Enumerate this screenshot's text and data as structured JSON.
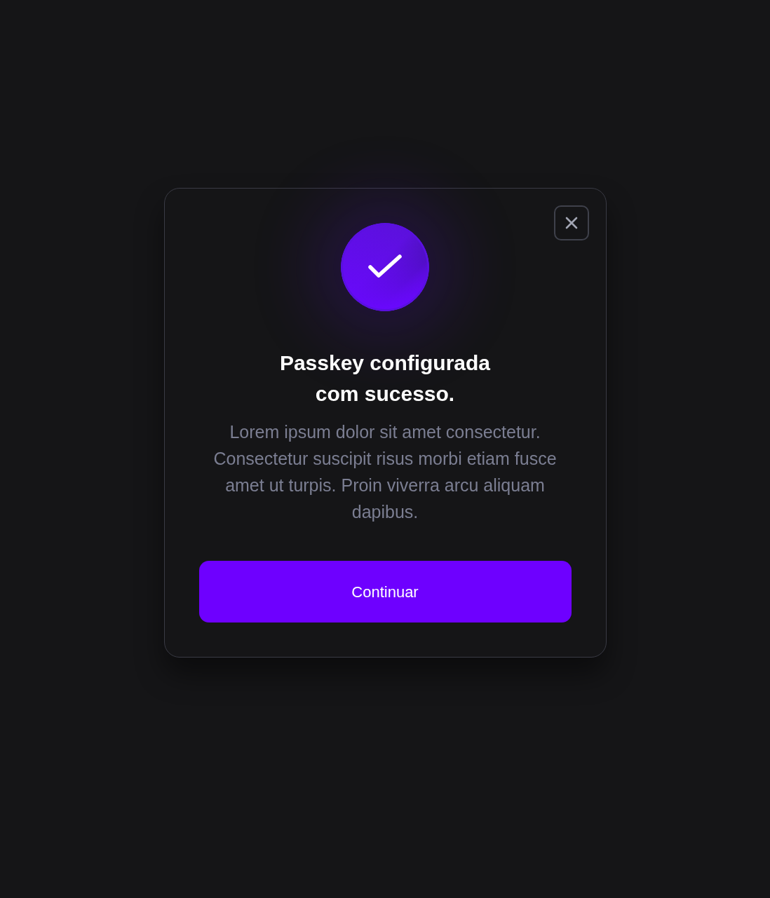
{
  "dialog": {
    "title": "Passkey configurada com sucesso.",
    "message": "Lorem ipsum dolor sit amet consectetur. Consectetur suscipit risus morbi etiam fusce amet ut turpis. Proin viverra arcu aliquam dapibus.",
    "primary_button": "Continuar"
  }
}
